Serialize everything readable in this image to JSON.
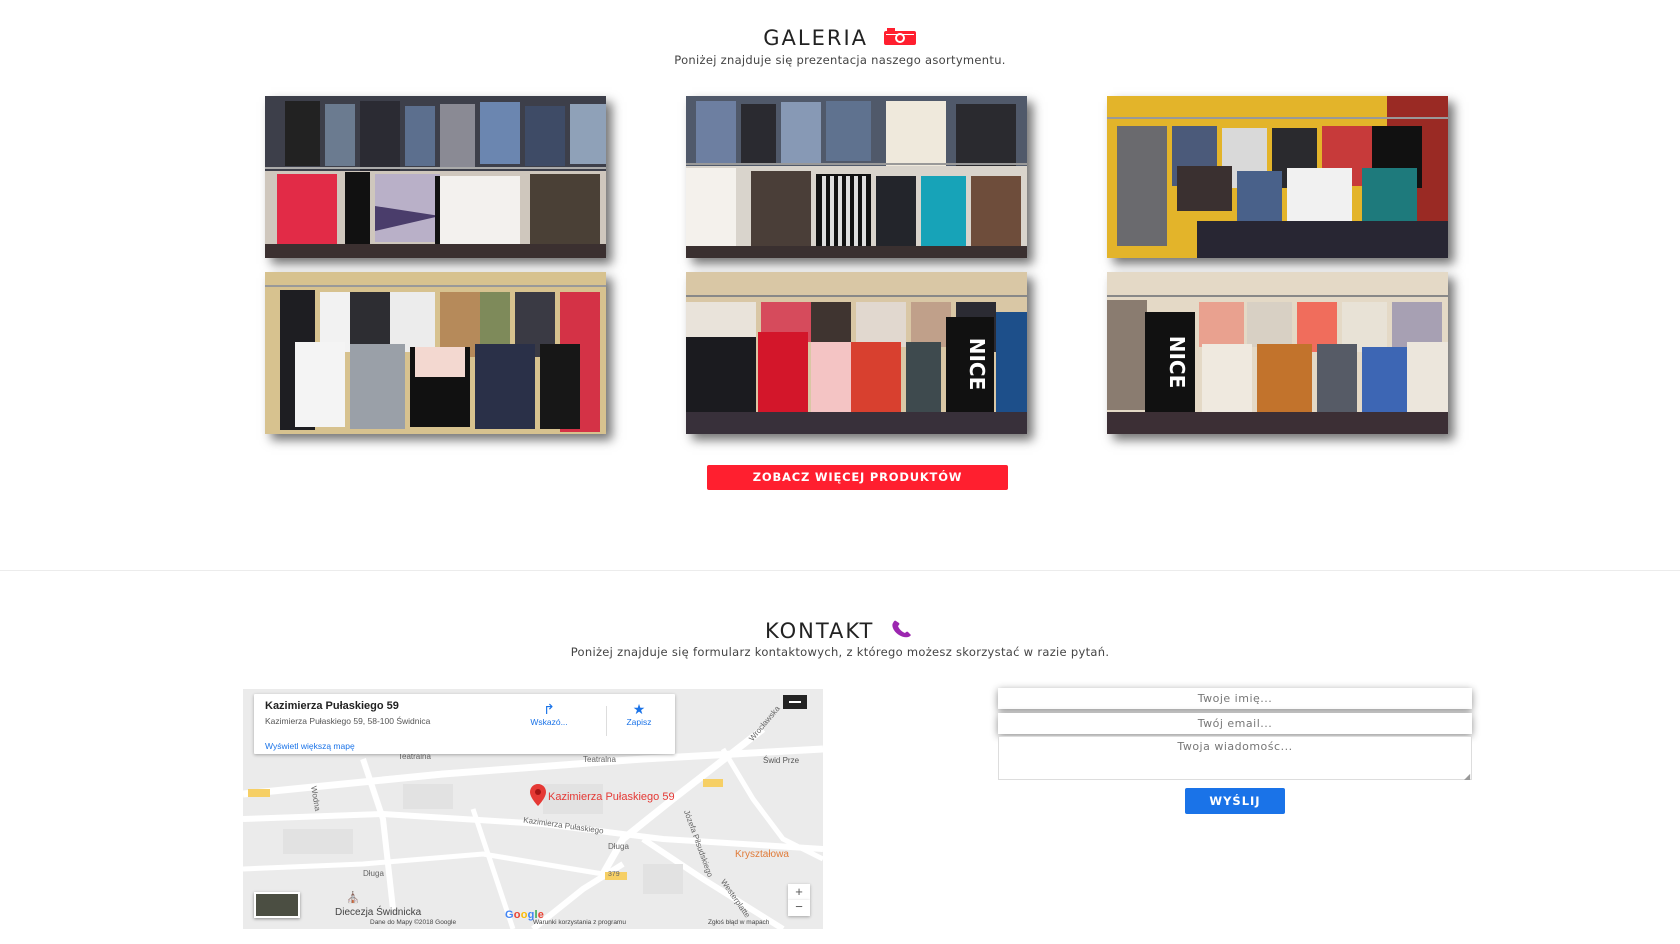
{
  "gallery": {
    "title": "GALERIA",
    "title_icon": "camera-icon",
    "subtitle": "Poniżej znajduje się prezentacja naszego asortymentu.",
    "more_button": "ZOBACZ WIĘCEJ PRODUKTÓW",
    "photos": [
      {
        "name": "clothes-photo-1"
      },
      {
        "name": "clothes-photo-2"
      },
      {
        "name": "clothes-photo-3"
      },
      {
        "name": "clothes-photo-4"
      },
      {
        "name": "clothes-photo-5",
        "shirt_text": "NICE"
      },
      {
        "name": "clothes-photo-6",
        "shirt_text": "NICE"
      }
    ]
  },
  "contact": {
    "title": "KONTAKT",
    "title_icon": "phone-icon",
    "subtitle": "Poniżej znajduje się formularz kontaktowych, z którego możesz skorzystać w razie pytań.",
    "form": {
      "name_placeholder": "Twoje imię...",
      "email_placeholder": "Twój email...",
      "message_placeholder": "Twoja wiadomośc...",
      "submit_label": "WYŚLIJ"
    }
  },
  "map": {
    "place_name": "Kazimierza Pułaskiego 59",
    "place_address": "Kazimierza Pułaskiego 59, 58-100 Świdnica",
    "bigger_map_link": "Wyświetl większą mapę",
    "directions_label": "Wskazó...",
    "save_label": "Zapisz",
    "pin_label": "Kazimierza Pułaskiego 59",
    "streets": {
      "teatralna_1": "Teatralna",
      "teatralna_2": "Teatralna",
      "pulaskiego": "Kazimierza Pułaskiego",
      "dluga_1": "Długa",
      "dluga_2": "Długa",
      "wroclawska": "Wrocławska",
      "westerplatte": "Westerplatte",
      "pilsudskiego": "Józefa Piłsudskiego",
      "wodna": "Wodna",
      "road_379": "379"
    },
    "poi_1": "Świd Prze",
    "poi_2": "Kryształowa",
    "poi_3": "Diecezja Świdnicka",
    "google": "Google",
    "footer_data": "Dane do Mapy ©2018 Google",
    "footer_terms": "Warunki korzystania z programu",
    "footer_report": "Zgłoś błąd w mapach",
    "zoom_in": "+",
    "zoom_out": "−"
  },
  "colors": {
    "accent_red": "#ff1f2f",
    "accent_blue": "#1a73e8",
    "phone_icon": "#9c27b0"
  }
}
